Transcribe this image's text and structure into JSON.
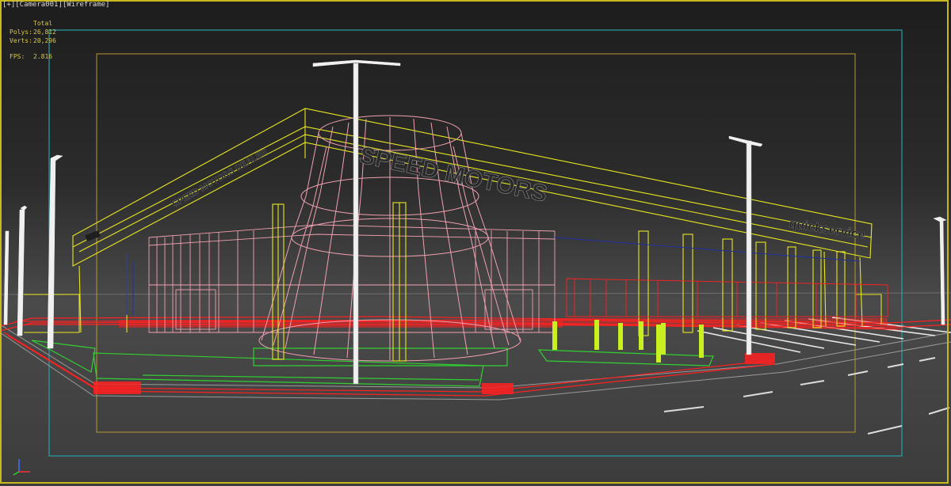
{
  "viewport": {
    "label": "[+][Camera001][Wireframe]",
    "stats": {
      "total_label": "Total",
      "polys_label": "Polys:",
      "polys_value": "26,812",
      "verts_label": "Verts:",
      "verts_value": "20,296",
      "fps_label": "FPS:",
      "fps_value": "2.816"
    }
  },
  "scene": {
    "signs": {
      "main": "SPEED MOTORS",
      "left": "SPEED MOTORS DEALER",
      "right": "quickservice"
    }
  },
  "colors": {
    "frame": "#c8b81e",
    "safe_frame_outer": "#2aa0a8",
    "safe_frame_inner": "#b89a30",
    "wire_yellow": "#e8e820",
    "wire_pink": "#f0a0b0",
    "wire_red": "#ff2020",
    "wire_green": "#30d030",
    "wire_white": "#f0f0f0"
  }
}
